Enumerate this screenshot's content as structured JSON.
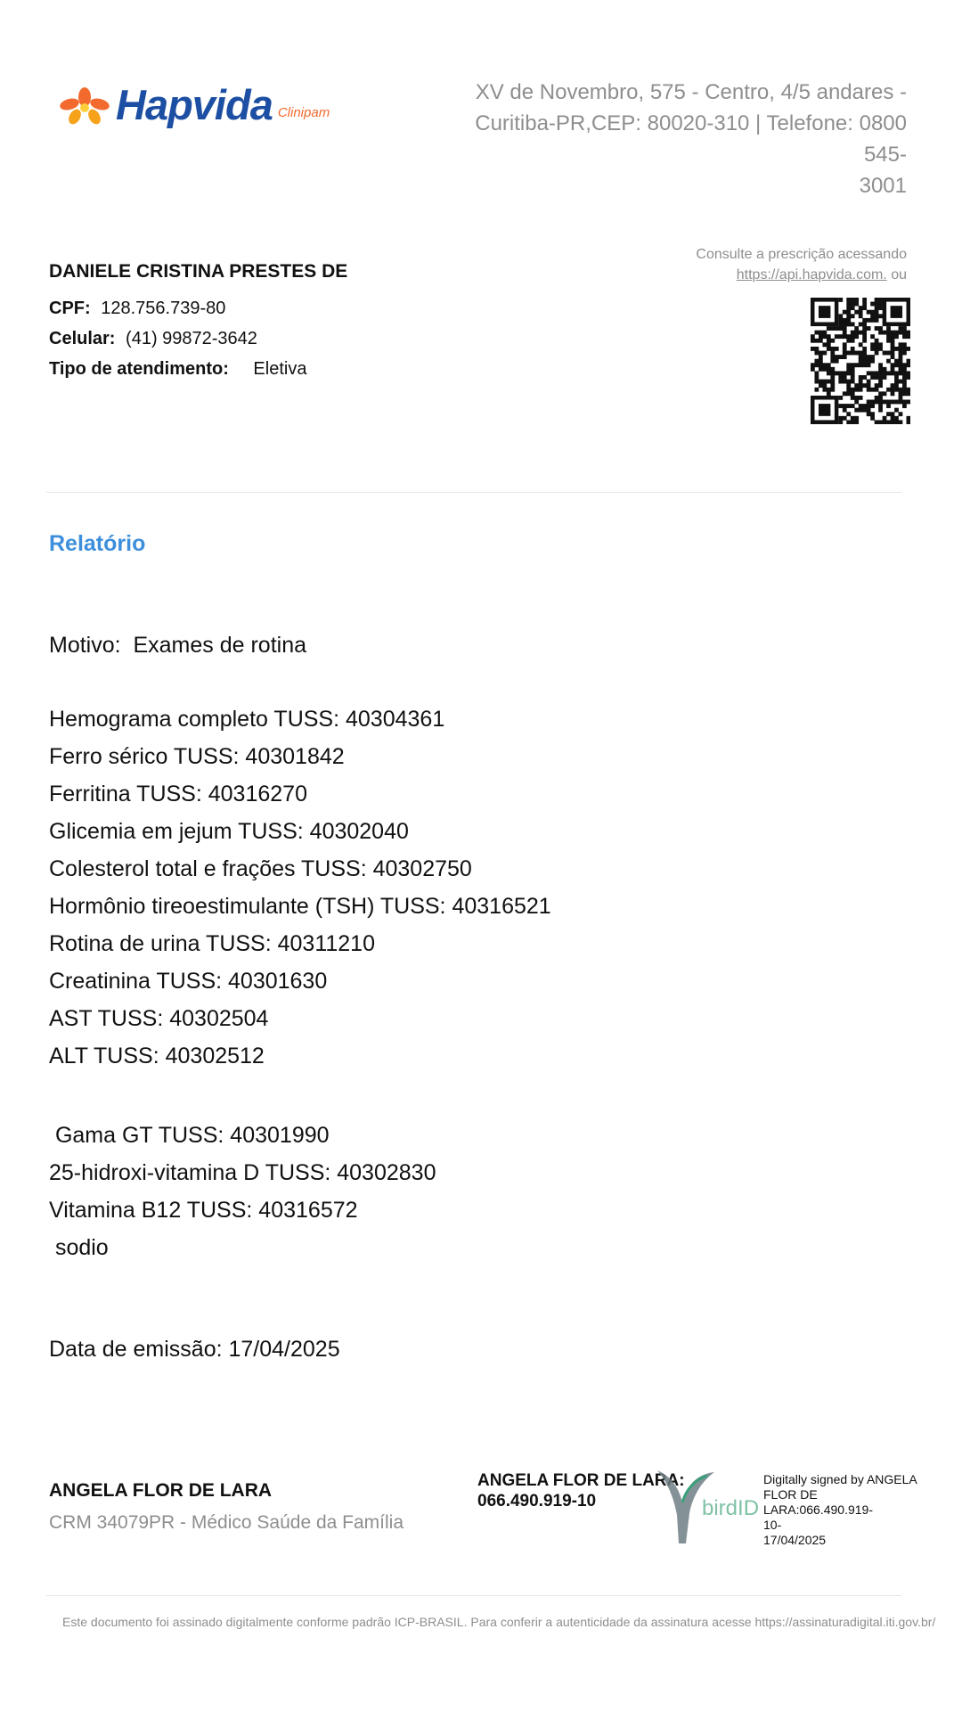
{
  "header": {
    "logo_text": "Hapvida",
    "logo_sub": "Clinipam",
    "address_lines": [
      "XV de Novembro, 575 - Centro, 4/5 andares -",
      "Curitiba-PR,CEP: 80020-310 | Telefone: 0800 545-",
      "3001"
    ]
  },
  "patient": {
    "name": "DANIELE CRISTINA PRESTES DE",
    "cpf_label": "CPF:",
    "cpf": "128.756.739-80",
    "phone_label": "Celular:",
    "phone": "(41) 99872-3642",
    "type_label": "Tipo de atendimento:",
    "type": "Eletiva"
  },
  "consult": {
    "line1": "Consulte a prescrição acessando",
    "link": "https://api.hapvida.com.",
    "suffix": " ou"
  },
  "report": {
    "title": "Relatório",
    "motivo": "Motivo:  Exames de rotina",
    "exams": [
      "Hemograma completo TUSS: 40304361",
      "Ferro sérico TUSS: 40301842",
      "Ferritina TUSS: 40316270",
      "Glicemia em jejum TUSS: 40302040",
      "Colesterol total e frações TUSS: 40302750",
      "Hormônio tireoestimulante (TSH) TUSS: 40316521",
      "Rotina de urina TUSS: 40311210",
      "Creatinina TUSS: 40301630",
      "AST TUSS: 40302504",
      "ALT TUSS: 40302512"
    ],
    "exams_extra": [
      " Gama GT TUSS: 40301990",
      "25-hidroxi-vitamina D TUSS: 40302830",
      "Vitamina B12 TUSS: 40316572",
      " sodio"
    ],
    "issue_date": "Data de emissão: 17/04/2025"
  },
  "doctor": {
    "name": "ANGELA FLOR DE LARA",
    "crm": "CRM  34079PR -    Médico Saúde da Família"
  },
  "signature": {
    "signer_line1": "ANGELA FLOR DE LARA:",
    "signer_line2": "066.490.919-10",
    "logo_text": "birdID",
    "info_lines": [
      "Digitally signed by ANGELA",
      "FLOR DE LARA:066.490.919-",
      "10-",
      "17/04/2025"
    ]
  },
  "footer": {
    "note": "Este documento foi assinado digitalmente conforme padrão ICP-BRASIL. Para conferir a autenticidade da assinatura acesse https://assinaturadigital.iti.gov.br/"
  }
}
